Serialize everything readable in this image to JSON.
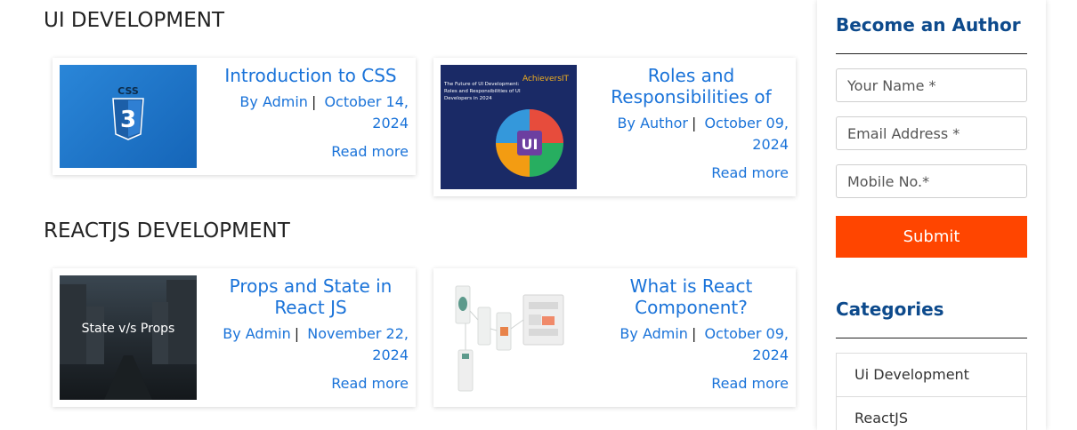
{
  "sections": [
    {
      "title": "UI DEVELOPMENT",
      "cards": [
        {
          "title": "Introduction to CSS",
          "author": "By Admin",
          "date": "October 14, 2024",
          "read_more": "Read more",
          "thumb_label": "CSS"
        },
        {
          "title": "Roles and Responsibilities of UI..",
          "author": "By Author",
          "date": "October 09, 2024",
          "read_more": "Read more",
          "thumb_text": "The Future of UI Development: Roles and Responsibilities of UI Developers in 2024",
          "thumb_brand": "AchieversIT",
          "thumb_center": "UI"
        }
      ]
    },
    {
      "title": "REACTJS DEVELOPMENT",
      "cards": [
        {
          "title": "Props and State in React JS",
          "author": "By Admin",
          "date": "November 22, 2024",
          "read_more": "Read more",
          "thumb_label": "State v/s Props"
        },
        {
          "title": "What is React Component?",
          "author": "By Admin",
          "date": "October 09, 2024",
          "read_more": "Read more"
        }
      ]
    }
  ],
  "sidebar": {
    "author_heading": "Become an Author",
    "name_placeholder": "Your Name *",
    "email_placeholder": "Email Address *",
    "mobile_placeholder": "Mobile No.*",
    "submit_label": "Submit",
    "categories_heading": "Categories",
    "categories": [
      "Ui Development",
      "ReactJS"
    ]
  },
  "colors": {
    "link": "#1a73d9",
    "heading": "#0d4a8c",
    "submit": "#ff4500"
  }
}
